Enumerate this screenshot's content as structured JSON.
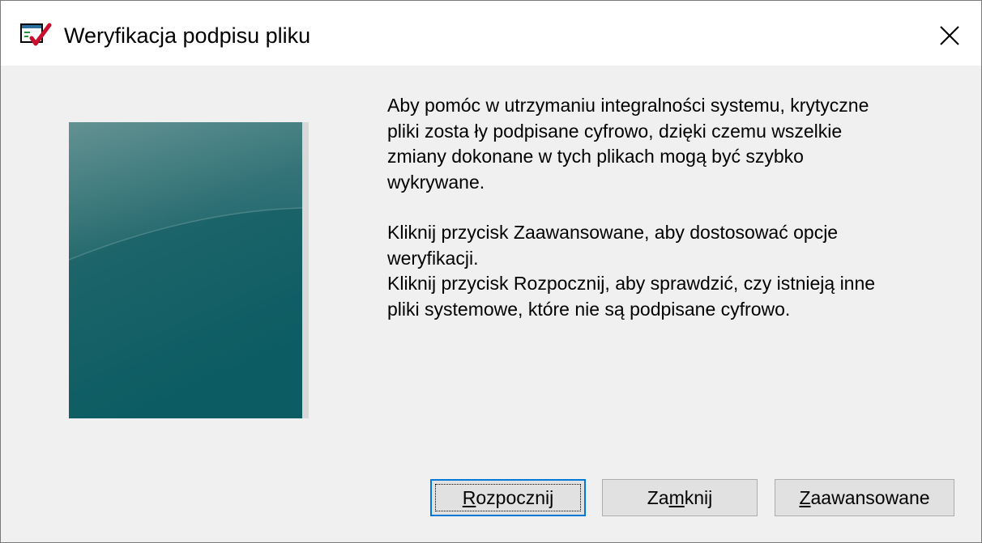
{
  "window": {
    "title": "Weryfikacja podpisu pliku",
    "icon": "sigverif-app-icon"
  },
  "message": {
    "paragraph1": [
      "Aby pomóc w utrzymaniu integralności systemu, krytyczne",
      "pliki zosta ły podpisane cyfrowo, dzięki czemu wszelkie",
      "zmiany dokonane w tych plikach mogą być szybko",
      "wykrywane."
    ],
    "paragraph2": [
      "Kliknij przycisk Zaawansowane, aby dostosować opcje",
      "weryfikacji.",
      "Kliknij przycisk Rozpocznij, aby sprawdzić, czy istnieją inne",
      "pliki systemowe, które nie są podpisane cyfrowo."
    ]
  },
  "buttons": {
    "start": {
      "mnemonic": "R",
      "rest": "ozpocznij"
    },
    "close": {
      "before": "Za",
      "mnemonic": "m",
      "after": "knij"
    },
    "advanced": {
      "mnemonic": "Z",
      "rest": "aawansowane"
    }
  },
  "colors": {
    "image_gradient_top": "#4a8080",
    "image_gradient_bottom": "#0b5c63",
    "default_button_border": "#0078d7"
  }
}
